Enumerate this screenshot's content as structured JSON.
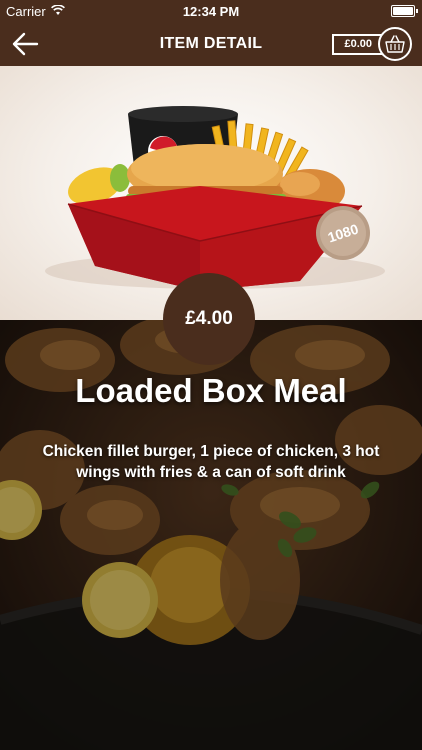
{
  "status_bar": {
    "carrier": "Carrier",
    "time": "12:34 PM",
    "battery_level": 1.0
  },
  "nav": {
    "title": "ITEM DETAIL",
    "back_icon": "arrow-left-icon",
    "cart_total": "£0.00",
    "cart_icon": "basket-icon"
  },
  "item": {
    "price": "£4.00",
    "name": "Loaded Box Meal",
    "description": "Chicken fillet burger, 1 piece of chicken, 3 hot wings with fries & a can of soft drink",
    "calorie_badge": "1080"
  },
  "colors": {
    "brand_brown": "#4a2d1d",
    "box_red": "#c8161d"
  }
}
